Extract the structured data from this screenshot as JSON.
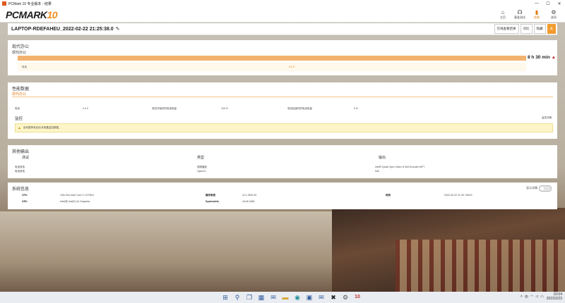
{
  "window": {
    "title": "PCMark 10 专业版本 - 结果"
  },
  "header": {
    "logo_main": "PCMARK",
    "logo_num": "10",
    "nav": [
      {
        "label": "主页",
        "icon": "home-icon"
      },
      {
        "label": "基准测试",
        "icon": "headset-icon"
      },
      {
        "label": "结果",
        "icon": "bar-chart-icon"
      },
      {
        "label": "选项",
        "icon": "gear-icon"
      }
    ]
  },
  "result": {
    "title": "LAPTOP-RDEFAHEU_2022-02-22 21:25:38.0",
    "buttons": [
      "在线查看结果",
      "对比",
      "隐藏",
      "关"
    ]
  },
  "modern": {
    "section_title": "现代办公",
    "bar_label": "现代办公",
    "score": "8 h 30 min",
    "row_left": "电池",
    "row_right": "4 h 0"
  },
  "perf": {
    "section_title": "性能数据",
    "tab": "现代办公",
    "metrics": [
      "电池",
      "4 h 0",
      "测试开始时的电池电量",
      "100 %",
      "测试结束时的电池电量",
      "5 %"
    ],
    "monitor_title": "监控",
    "monitor_right": "监控详情",
    "warning": "自动暂停未启动,未收集监控数据。"
  },
  "other": {
    "section_title": "其他输出",
    "col_test": "测试",
    "col_type": "类型",
    "col_output": "输出",
    "row1": [
      "电池放电",
      "视频播放",
      "Intel® Quick Sync Video H.264 Encoder MFT"
    ],
    "row2": [
      "电池放电",
      "OpenCL",
      "N/A"
    ]
  },
  "system": {
    "section_title": "系统信息",
    "toggle_label": "显示详情",
    "items": [
      {
        "k": "CPU",
        "v": "12th Gen Intel Core i7-1270EU"
      },
      {
        "k": "操作系统",
        "v": "v2.1.2532 64"
      },
      {
        "k": "时间",
        "v": "2022-02-22 21:25 +08:00"
      },
      {
        "k": "GPU",
        "v": "Intel(R) Iris(R) Xe Graphics"
      },
      {
        "k": "SystemInfo",
        "v": "v5.46.1056"
      }
    ]
  },
  "taskbar": {
    "time": "10:04",
    "date": "2022/2/23",
    "lang": "中",
    "apps": [
      "start-icon",
      "search-icon",
      "task-view-icon",
      "widgets-icon",
      "chat-icon",
      "explorer-icon",
      "edge-icon",
      "store-icon",
      "mail-icon",
      "xbox-icon",
      "settings-icon",
      "pcmark-icon"
    ]
  }
}
